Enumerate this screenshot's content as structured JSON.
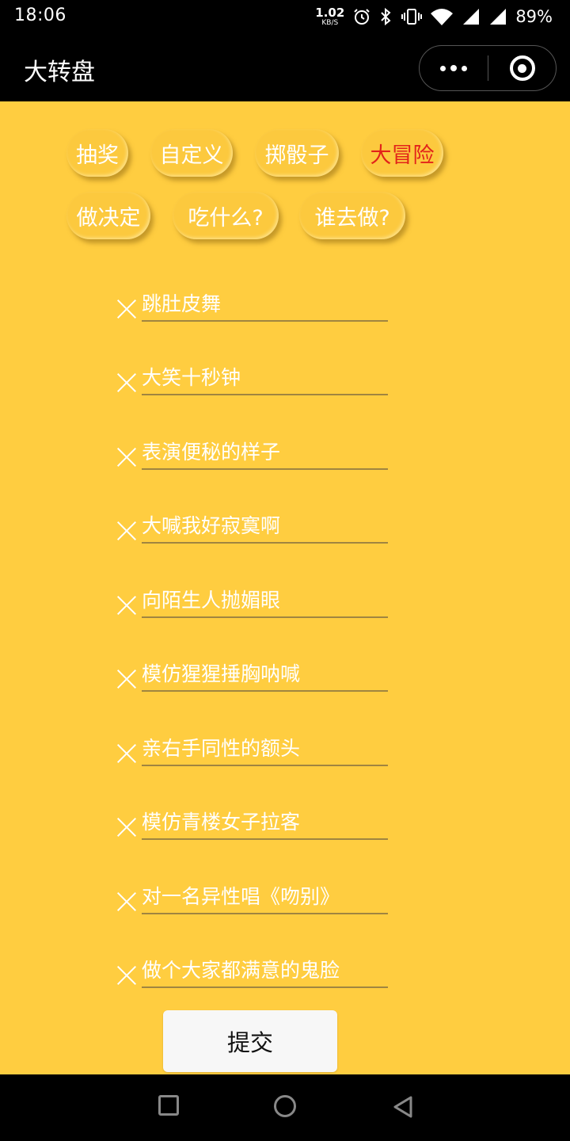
{
  "status_bar": {
    "time": "18:06",
    "net_speed_value": "1.02",
    "net_speed_unit": "KB/S",
    "battery": "89%"
  },
  "title_bar": {
    "title": "大转盘",
    "more_icon": "more-dots-icon",
    "close_icon": "target-close-icon"
  },
  "tabs": [
    {
      "label": "抽奖",
      "active": false
    },
    {
      "label": "自定义",
      "active": false
    },
    {
      "label": "掷骰子",
      "active": false
    },
    {
      "label": "大冒险",
      "active": true
    },
    {
      "label": "做决定",
      "active": false
    },
    {
      "label": "吃什么?",
      "active": false
    },
    {
      "label": "谁去做?",
      "active": false
    }
  ],
  "items": [
    "跳肚皮舞",
    "大笑十秒钟",
    "表演便秘的样子",
    "大喊我好寂寞啊",
    "向陌生人抛媚眼",
    "模仿猩猩捶胸呐喊",
    "亲右手同性的额头",
    "模仿青楼女子拉客",
    "对一名异性唱《吻别》",
    "做个大家都满意的鬼脸"
  ],
  "submit_label": "提交",
  "colors": {
    "background": "#ffcd40",
    "active_tab_text": "#e2231a",
    "tab_text": "#ffffff"
  }
}
